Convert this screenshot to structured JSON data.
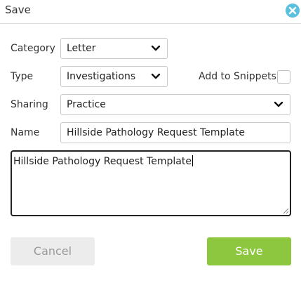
{
  "dialog": {
    "title": "Save",
    "close_icon": "close-icon"
  },
  "form": {
    "category": {
      "label": "Category",
      "value": "Letter"
    },
    "type": {
      "label": "Type",
      "value": "Investigations"
    },
    "snippets": {
      "label": "Add to Snippets",
      "checked": false
    },
    "sharing": {
      "label": "Sharing",
      "value": "Practice"
    },
    "name": {
      "label": "Name",
      "value": "Hillside Pathology Request Template"
    },
    "body": {
      "value": "Hillside Pathology Request Template"
    }
  },
  "buttons": {
    "cancel": "Cancel",
    "save": "Save"
  },
  "colors": {
    "close": "#5bc0de",
    "save": "#8dc63f",
    "cancel_bg": "#ececec"
  }
}
